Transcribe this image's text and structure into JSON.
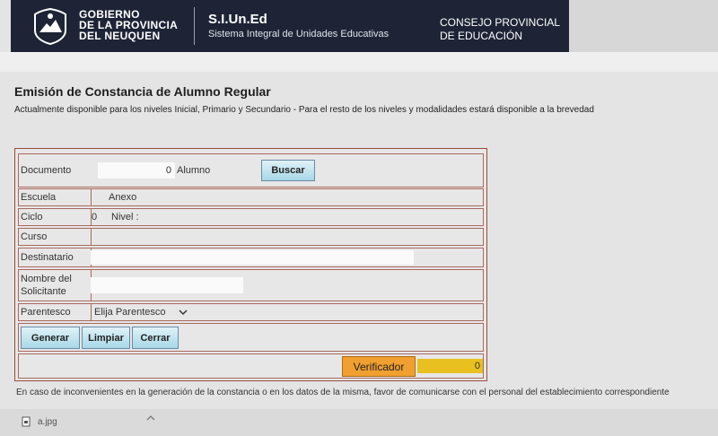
{
  "header": {
    "gov_line1": "GOBIERNO",
    "gov_line2": "DE LA PROVINCIA",
    "gov_line3": "DEL NEUQUEN",
    "system_name": "S.I.Un.Ed",
    "system_desc": "Sistema Integral de Unidades Educativas",
    "council_line1": "CONSEJO PROVINCIAL",
    "council_line2": "DE EDUCACIÓN"
  },
  "page": {
    "title": "Emisión de Constancia de Alumno Regular",
    "subtitle": "Actualmente disponible para los niveles Inicial, Primario y Secundario - Para el resto de los niveles y modalidades estará disponible a la brevedad"
  },
  "form": {
    "documento_label": "Documento",
    "documento_value": "0",
    "alumno_label": "Alumno",
    "buscar_label": "Buscar",
    "escuela_label": "Escuela",
    "anexo_label": "Anexo",
    "ciclo_label": "Ciclo",
    "ciclo_value": "0",
    "nivel_label": "Nivel :",
    "curso_label": "Curso",
    "destinatario_label": "Destinatario",
    "solicitante_label_line1": "Nombre del",
    "solicitante_label_line2": "Solicitante",
    "parentesco_label": "Parentesco",
    "parentesco_selected": "Elija Parentesco",
    "generar_label": "Generar",
    "limpiar_label": "Limpiar",
    "cerrar_label": "Cerrar",
    "verificador_label": "Verificador",
    "verificador_value": "0"
  },
  "footer": {
    "note": "En caso de inconvenientes en la generación de la constancia o en los datos de la misma, favor de comunicarse con el personal del establecimiento correspondiente"
  },
  "download": {
    "file_name": "a.jpg",
    "icon": "file-icon",
    "chevron": "chevron-up-icon"
  },
  "colors": {
    "header_bg": "#1e2436",
    "button_bg": "#a8d8e6",
    "verificador_btn": "#f0a030",
    "verificador_field": "#e8c020",
    "form_border": "#9a4a3a"
  }
}
